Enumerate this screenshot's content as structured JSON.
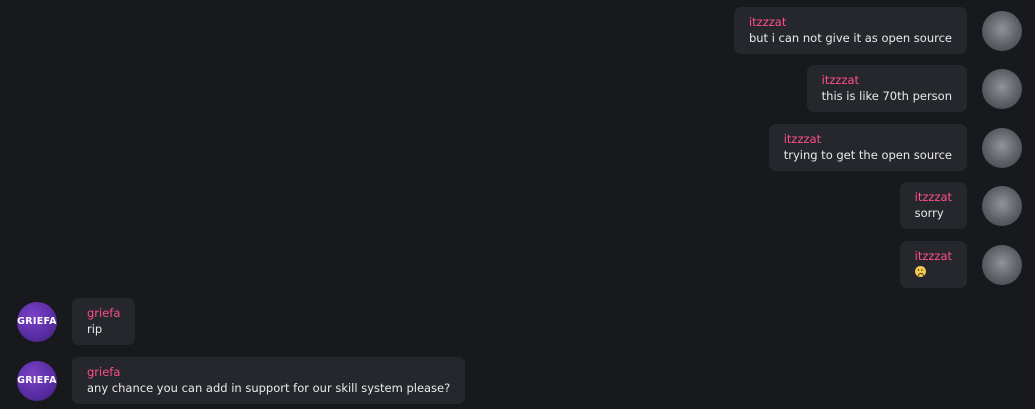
{
  "messages": [
    {
      "direction": "out",
      "author": "itzzzat",
      "text": "but i can not give it as open source",
      "avatar": "profile-photo-avatar"
    },
    {
      "direction": "out",
      "author": "itzzzat",
      "text": "this is like 70th person",
      "avatar": "profile-photo-avatar"
    },
    {
      "direction": "out",
      "author": "itzzzat",
      "text": "trying to get the open source",
      "avatar": "profile-photo-avatar"
    },
    {
      "direction": "out",
      "author": "itzzzat",
      "text": "sorry",
      "avatar": "profile-photo-avatar"
    },
    {
      "direction": "out",
      "author": "itzzzat",
      "text": "",
      "emoji": "frowning-face-emoji",
      "avatar": "profile-photo-avatar"
    },
    {
      "direction": "in",
      "author": "griefa",
      "text": "rip",
      "avatar": "griefa-logo-avatar",
      "avatar_text": "GRIEFA"
    },
    {
      "direction": "in",
      "author": "griefa",
      "text": "any chance you can add in support for our skill system please?",
      "avatar": "griefa-logo-avatar",
      "avatar_text": "GRIEFA"
    }
  ],
  "colors": {
    "background": "#17191c",
    "bubble": "#25272c",
    "author": "#ff4f8a",
    "text": "#e9eaec"
  }
}
